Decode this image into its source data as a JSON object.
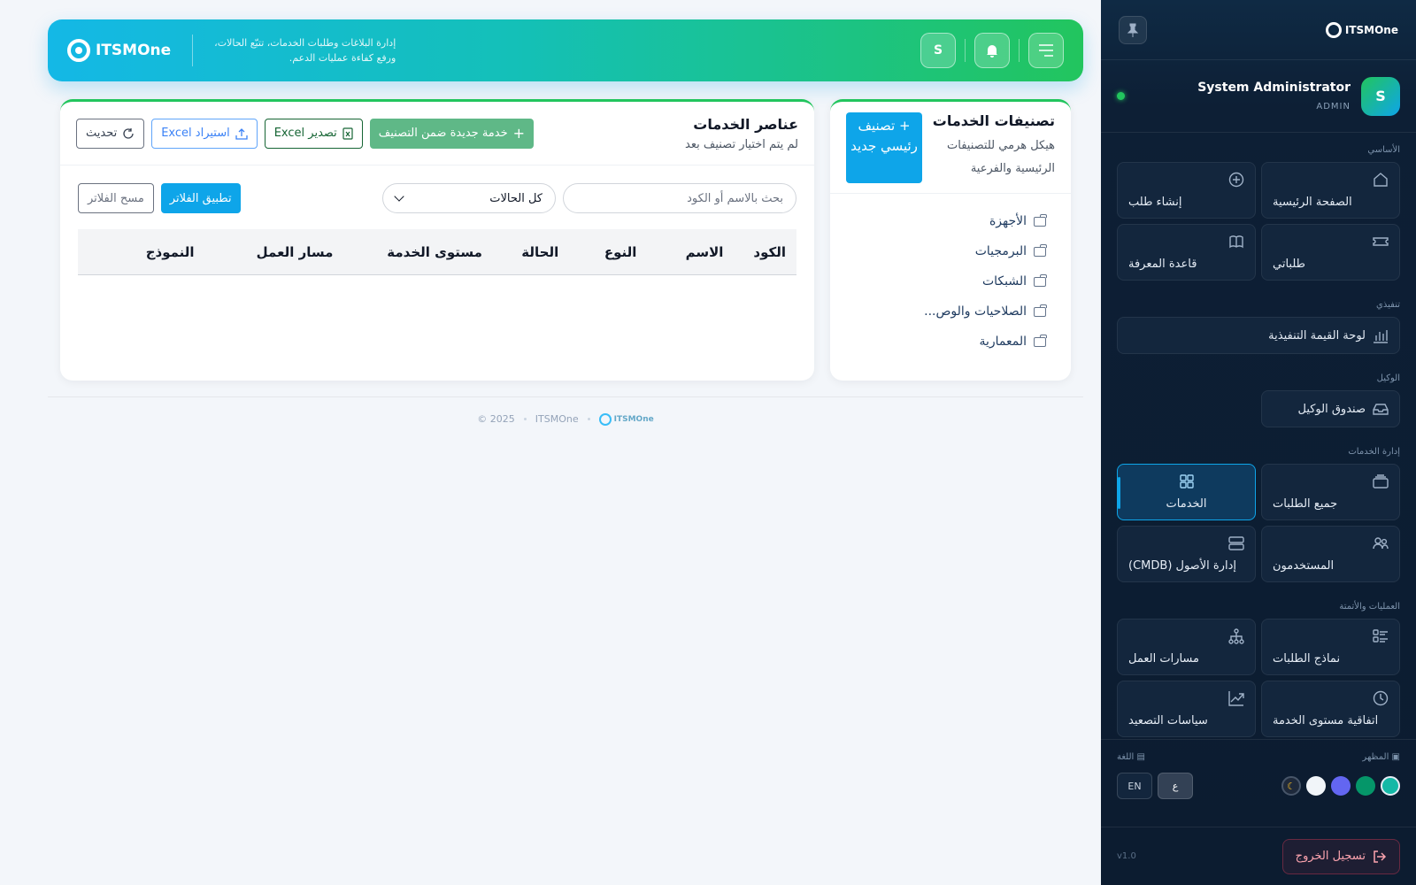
{
  "app": {
    "name": "ITSMOne"
  },
  "header": {
    "logo": "ITSMOne",
    "tagline_line1": "إدارة البلاغات وطلبات الخدمات، تتبّع الحالات،",
    "tagline_line2": "ورفع كفاءة عمليات الدعم.",
    "user_initial": "S"
  },
  "sidebar": {
    "logo": "ITSMOne",
    "user": {
      "name": "System Administrator",
      "role": "ADMIN",
      "initial": "S"
    },
    "sections": [
      {
        "title": "الأساسي",
        "items": [
          {
            "label": "الصفحة الرئيسية",
            "icon": "home-icon"
          },
          {
            "label": "إنشاء طلب",
            "icon": "plus-circle-icon"
          },
          {
            "label": "طلباتي",
            "icon": "ticket-icon"
          },
          {
            "label": "قاعدة المعرفة",
            "icon": "book-icon"
          }
        ]
      },
      {
        "title": "تنفيذي",
        "items": [
          {
            "label": "لوحة القيمة التنفيذية",
            "icon": "bar-chart-icon"
          }
        ]
      },
      {
        "title": "الوكيل",
        "items": [
          {
            "label": "صندوق الوكيل",
            "icon": "inbox-icon"
          }
        ]
      },
      {
        "title": "إدارة الخدمات",
        "items": [
          {
            "label": "جميع الطلبات",
            "icon": "layers-icon"
          },
          {
            "label": "الخدمات",
            "icon": "grid-icon",
            "active": true
          },
          {
            "label": "المستخدمون",
            "icon": "users-icon"
          },
          {
            "label": "إدارة الأصول (CMDB)",
            "icon": "server-icon"
          }
        ]
      },
      {
        "title": "العمليات والأتمتة",
        "items": [
          {
            "label": "نماذج الطلبات",
            "icon": "form-list-icon"
          },
          {
            "label": "مسارات العمل",
            "icon": "workflow-icon"
          },
          {
            "label": "اتفاقية مستوى الخدمة",
            "icon": "clock-icon"
          },
          {
            "label": "سياسات التصعيد",
            "icon": "trend-up-icon"
          }
        ]
      }
    ],
    "appearance_label": "المظهر",
    "language_label": "اللغة",
    "themes": [
      "#14b8a6",
      "#059669",
      "#6366f1",
      "#f1f5f9",
      "#1e293b"
    ],
    "languages": [
      "ع",
      "EN"
    ],
    "logout_label": "تسجيل الخروج",
    "version": "v1.0"
  },
  "categories": {
    "title": "تصنيفات الخدمات",
    "subtitle": "هيكل هرمي للتصنيفات الرئيسية والفرعية",
    "new_button": "+ تصنيف رئيسي جديد",
    "items": [
      "الأجهزة",
      "البرمجيات",
      "الشبكات",
      "الصلاحيات والوص...",
      "المعمارية"
    ]
  },
  "services": {
    "title": "عناصر الخدمات",
    "subtitle": "لم يتم اختيار تصنيف بعد",
    "new_button": "خدمة جديدة ضمن التصنيف",
    "export_button": "تصدير Excel",
    "import_button": "استيراد Excel",
    "refresh_button": "تحديث",
    "search_placeholder": "بحث بالاسم أو الكود",
    "status_filter": "كل الحالات",
    "apply_button": "تطبيق الفلاتر",
    "clear_button": "مسح الفلاتر",
    "columns": [
      "الكود",
      "الاسم",
      "النوع",
      "الحالة",
      "مستوى الخدمة",
      "مسار العمل",
      "النموذج"
    ]
  },
  "footer": {
    "logo": "ITSMOne",
    "app": "ITSMOne",
    "copyright": "© 2025"
  }
}
